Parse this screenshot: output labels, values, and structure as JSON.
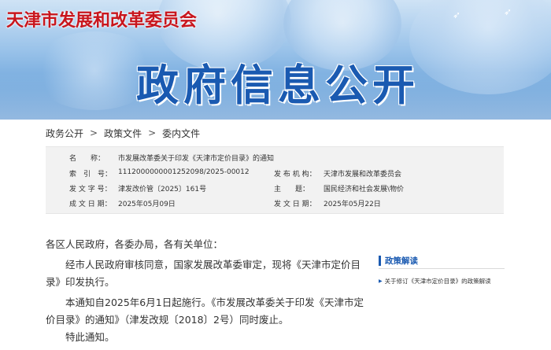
{
  "header": {
    "site_title": "天津市发展和改革委员会",
    "banner_title": "政府信息公开"
  },
  "breadcrumb": {
    "items": [
      "政务公开",
      "政策文件",
      "委内文件"
    ],
    "separator": ">"
  },
  "info": {
    "name_label": "名　　称：",
    "name_value": "市发展改革委关于印发《天津市定价目录》的通知",
    "index_label": "索　引　号：",
    "index_value": "1112000000001252098/2025-00012",
    "issuer_label": "发 布 机 构：",
    "issuer_value": "天津市发展和改革委员会",
    "docno_label": "发 文 字 号：",
    "docno_value": "津发改价管〔2025〕161号",
    "topic_label": "主　　题：",
    "topic_value": "国民经济和社会发展\\物价",
    "date_label": "成 文 日 期：",
    "date_value": "2025年05月09日",
    "pubdate_label": "发 文 日 期：",
    "pubdate_value": "2025年05月22日"
  },
  "body": {
    "salutation": "各区人民政府，各委办局，各有关单位：",
    "para1": "经市人民政府审核同意，国家发展改革委审定，现将《天津市定价目录》印发执行。",
    "para2": "本通知自2025年6月1日起施行。《市发展改革委关于印发《天津市定价目录》的通知》（津发改规〔2018〕2号）同时废止。",
    "para3": "特此通知。"
  },
  "sidebar": {
    "title": "政策解读",
    "items": [
      "关于修订《天津市定价目录》的政策解读"
    ]
  },
  "colors": {
    "site_title": "#c8161d",
    "banner_title": "#1a5ab1",
    "accent": "#1a5ab1"
  }
}
